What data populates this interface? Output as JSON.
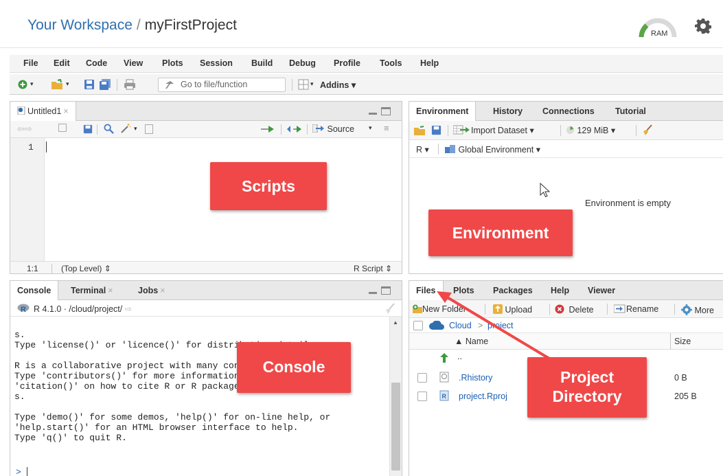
{
  "header": {
    "workspace_link": "Your Workspace",
    "separator": "/",
    "project_name": "myFirstProject",
    "ram_label": "RAM",
    "settings_icon": "gear-icon"
  },
  "menu": [
    "File",
    "Edit",
    "Code",
    "View",
    "Plots",
    "Session",
    "Build",
    "Debug",
    "Profile",
    "Tools",
    "Help"
  ],
  "toolbar": {
    "goto_placeholder": "Go to file/function",
    "addins_label": "Addins"
  },
  "source_pane": {
    "tab_label": "Untitled1",
    "source_label": "Source",
    "line_number": "1",
    "cursor_pos": "1:1",
    "scope_label": "(Top Level)",
    "file_type": "R Script"
  },
  "env_pane": {
    "tabs": [
      "Environment",
      "History",
      "Connections",
      "Tutorial"
    ],
    "import_label": "Import Dataset",
    "memory_label": "129 MiB",
    "lang_label": "R",
    "scope_label": "Global Environment",
    "empty_message": "Environment is empty"
  },
  "console_pane": {
    "tabs": [
      "Console",
      "Terminal",
      "Jobs"
    ],
    "r_version": "R 4.1.0",
    "path": "/cloud/project/",
    "lines": [
      "s.",
      "Type 'license()' or 'licence()' for distribution details.",
      "",
      "R is a collaborative project with many contributors.",
      "Type 'contributors()' for more information and",
      "'citation()' on how to cite R or R packages in publication",
      "s.",
      "",
      "Type 'demo()' for some demos, 'help()' for on-line help, or",
      "'help.start()' for an HTML browser interface to help.",
      "Type 'q()' to quit R."
    ],
    "prompt": ">"
  },
  "files_pane": {
    "tabs": [
      "Files",
      "Plots",
      "Packages",
      "Help",
      "Viewer"
    ],
    "new_folder": "New Folder",
    "upload": "Upload",
    "delete": "Delete",
    "rename": "Rename",
    "more": "More",
    "breadcrumb_root": "Cloud",
    "breadcrumb_sep": ">",
    "breadcrumb_dir": "project",
    "col_name": "▲ Name",
    "col_size": "Size",
    "up_label": "..",
    "files": [
      {
        "name": ".Rhistory",
        "size": "0 B"
      },
      {
        "name": "project.Rproj",
        "size": "205 B"
      }
    ]
  },
  "callouts": {
    "scripts": "Scripts",
    "environment": "Environment",
    "console": "Console",
    "project_directory_line1": "Project",
    "project_directory_line2": "Directory"
  },
  "colors": {
    "callout": "#f04848",
    "link": "#1a5fb4",
    "accent_blue": "#2f6fae"
  }
}
